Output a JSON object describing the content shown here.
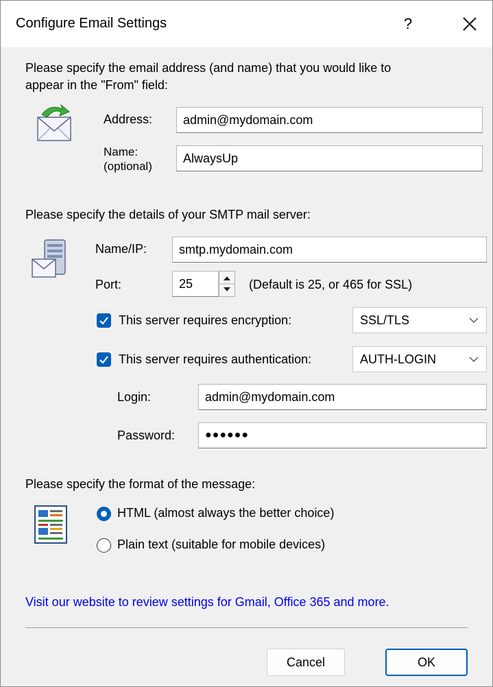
{
  "dialog": {
    "title": "Configure Email Settings",
    "help_label": "?",
    "close_icon": "close-icon"
  },
  "from_section": {
    "intro_line1": "Please specify the email address (and name) that you would like to",
    "intro_line2": "appear in the \"From\" field:",
    "address_label": "Address:",
    "address_value": "admin@mydomain.com",
    "name_label_line1": "Name:",
    "name_label_line2": "(optional)",
    "name_value": "AlwaysUp",
    "icon": "envelope-arrow-icon"
  },
  "smtp_section": {
    "intro": "Please specify the details of your SMTP mail server:",
    "name_ip_label": "Name/IP:",
    "name_ip_value": "smtp.mydomain.com",
    "port_label": "Port:",
    "port_value": "25",
    "port_hint": "(Default is 25, or 465 for SSL)",
    "encryption_label": "This server requires encryption:",
    "encryption_checked": true,
    "encryption_value": "SSL/TLS",
    "auth_label": "This server requires authentication:",
    "auth_checked": true,
    "auth_value": "AUTH-LOGIN",
    "login_label": "Login:",
    "login_value": "admin@mydomain.com",
    "password_label": "Password:",
    "password_value": "●●●●●●",
    "icon": "server-mail-icon"
  },
  "format_section": {
    "intro": "Please specify the format  of the message:",
    "html_option": "HTML (almost always the better choice)",
    "plain_option": "Plain text (suitable for mobile devices)",
    "selected": "html",
    "icon": "document-format-icon"
  },
  "footer": {
    "link_text": "Visit our website to review settings for Gmail, Office 365 and more.",
    "cancel_label": "Cancel",
    "ok_label": "OK"
  },
  "colors": {
    "accent": "#005fb8",
    "link": "#0000ee",
    "background": "#f0f0f0"
  }
}
